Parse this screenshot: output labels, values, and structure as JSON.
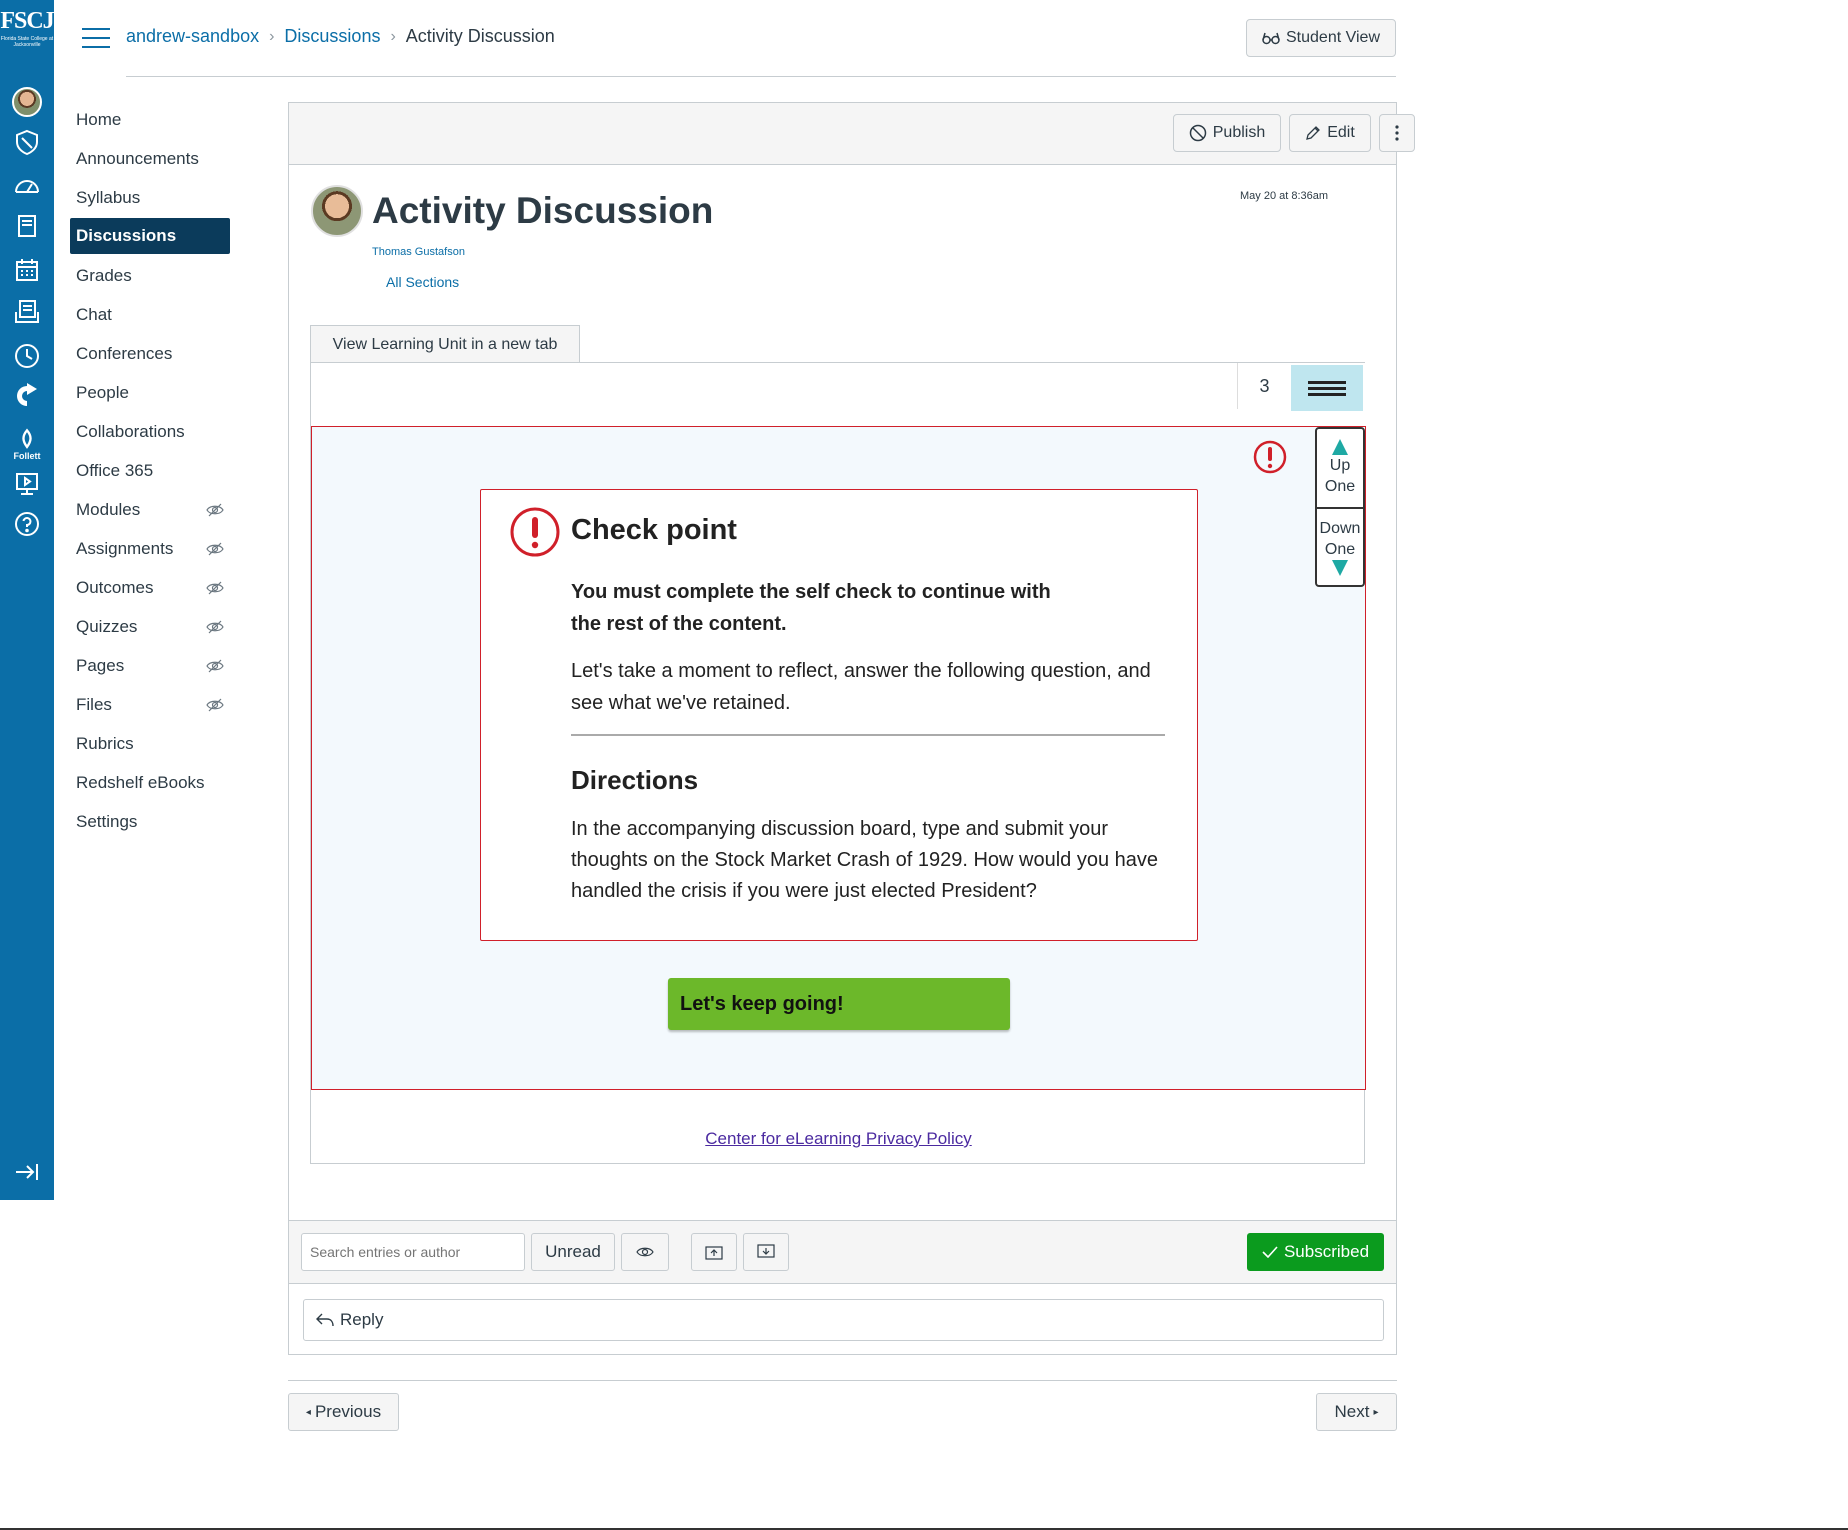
{
  "global_nav": {
    "logo_text": "FSCJ",
    "logo_subtext": "Florida State College at Jacksonville",
    "follett_label": "Follett",
    "items": [
      "account-avatar",
      "admin-icon",
      "dashboard-icon",
      "courses-icon",
      "calendar-icon",
      "inbox-icon",
      "history-icon",
      "commons-icon",
      "follett-icon",
      "studio-icon",
      "help-icon",
      "collapse-icon"
    ]
  },
  "header": {
    "breadcrumb": [
      "andrew-sandbox",
      "Discussions",
      "Activity Discussion"
    ],
    "student_view": "Student View"
  },
  "course_nav": {
    "items": [
      {
        "label": "Home",
        "hidden": false
      },
      {
        "label": "Announcements",
        "hidden": false
      },
      {
        "label": "Syllabus",
        "hidden": false
      },
      {
        "label": "Discussions",
        "hidden": false,
        "active": true
      },
      {
        "label": "Grades",
        "hidden": false
      },
      {
        "label": "Chat",
        "hidden": false
      },
      {
        "label": "Conferences",
        "hidden": false
      },
      {
        "label": "People",
        "hidden": false
      },
      {
        "label": "Collaborations",
        "hidden": false
      },
      {
        "label": "Office 365",
        "hidden": false
      },
      {
        "label": "Modules",
        "hidden": true
      },
      {
        "label": "Assignments",
        "hidden": true
      },
      {
        "label": "Outcomes",
        "hidden": true
      },
      {
        "label": "Quizzes",
        "hidden": true
      },
      {
        "label": "Pages",
        "hidden": true
      },
      {
        "label": "Files",
        "hidden": true
      },
      {
        "label": "Rubrics",
        "hidden": false
      },
      {
        "label": "Redshelf eBooks",
        "hidden": false
      },
      {
        "label": "Settings",
        "hidden": false
      }
    ]
  },
  "toolbar": {
    "publish_label": "Publish",
    "edit_label": "Edit"
  },
  "post": {
    "title": "Activity Discussion",
    "date": "May 20 at 8:36am",
    "author": "Thomas Gustafson",
    "sections": "All Sections"
  },
  "learning_unit": {
    "view_tab_label": "View Learning Unit in a new tab",
    "page_number": "3",
    "up_label_1": "Up",
    "up_label_2": "One",
    "down_label_1": "Down",
    "down_label_2": "One",
    "checkpoint_title": "Check point",
    "checkpoint_must": "You must complete the self check to continue with the rest of the content.",
    "checkpoint_reflect": "Let's take a moment to reflect, answer the following question, and see what we've retained.",
    "directions_title": "Directions",
    "directions_text": "In the accompanying discussion board, type and submit your thoughts on the Stock Market Crash of 1929. How would you have handled the crisis if you were just elected President?",
    "keep_going": "Let's keep going!",
    "privacy_link": "Center for eLearning Privacy Policy",
    "colors": {
      "alert": "#d0202a",
      "button": "#6cb82a",
      "arrows": "#1ea9a4"
    }
  },
  "actions": {
    "search_placeholder": "Search entries or author",
    "unread_label": "Unread",
    "subscribed_label": "Subscribed",
    "reply_label": "Reply"
  },
  "pager": {
    "previous": "Previous",
    "next": "Next"
  },
  "colors": {
    "brand": "#0b6ea7",
    "active_nav": "#0b3b5b",
    "subscribed": "#0b9b1e"
  }
}
